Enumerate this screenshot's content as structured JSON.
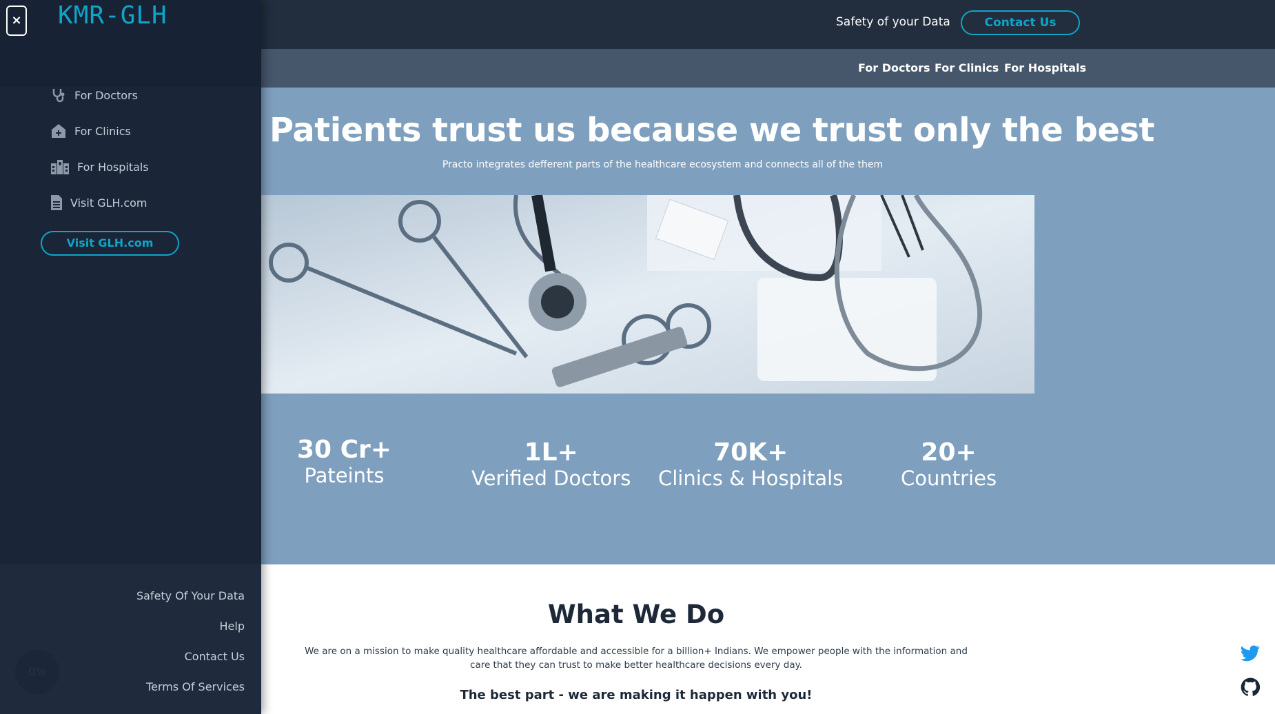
{
  "topbar": {
    "safety_link": "Safety of your Data",
    "contact_button": "Contact Us"
  },
  "subnav": {
    "items": [
      "For Doctors",
      "For Clinics",
      "For Hospitals"
    ]
  },
  "hero": {
    "title": "Patients trust us because we trust only the best",
    "subtitle": "Practo integrates defferent parts of the healthcare ecosystem and connects all of the them",
    "image_alt": "medical instruments photo",
    "stats": [
      {
        "number": "30 Cr+",
        "label": "Pateints"
      },
      {
        "number": "1L+",
        "label": "Verified Doctors"
      },
      {
        "number": "70K+",
        "label": "Clinics & Hospitals"
      },
      {
        "number": "20+",
        "label": "Countries"
      }
    ]
  },
  "whatwedo": {
    "title": "What We Do",
    "text": "We are on a mission to make quality healthcare affordable and accessible for a billion+ Indians. We empower people with the information and care that they can trust to make better healthcare decisions every day.",
    "best_part": "The best part - we are making it happen with you!"
  },
  "social": {
    "icons": [
      "twitter-icon",
      "github-icon"
    ]
  },
  "sidebar": {
    "close_symbol": "×",
    "logo": "KMR-GLH",
    "items": [
      {
        "label": "For Doctors",
        "icon": "stethoscope-icon"
      },
      {
        "label": "For Clinics",
        "icon": "clinic-icon"
      },
      {
        "label": "For Hospitals",
        "icon": "hospital-icon"
      },
      {
        "label": "Visit GLH.com",
        "icon": "document-icon"
      }
    ],
    "visit_button": "Visit GLH.com",
    "footer_links": [
      "Safety Of Your Data",
      "Help",
      "Contact Us",
      "Terms Of Services"
    ],
    "progress": "0%"
  },
  "colors": {
    "accent": "#0ea5c9",
    "topbar": "#222d3d",
    "subnav": "#46566b",
    "hero": "#7e9fbd",
    "sidebar": "#1a2638"
  }
}
